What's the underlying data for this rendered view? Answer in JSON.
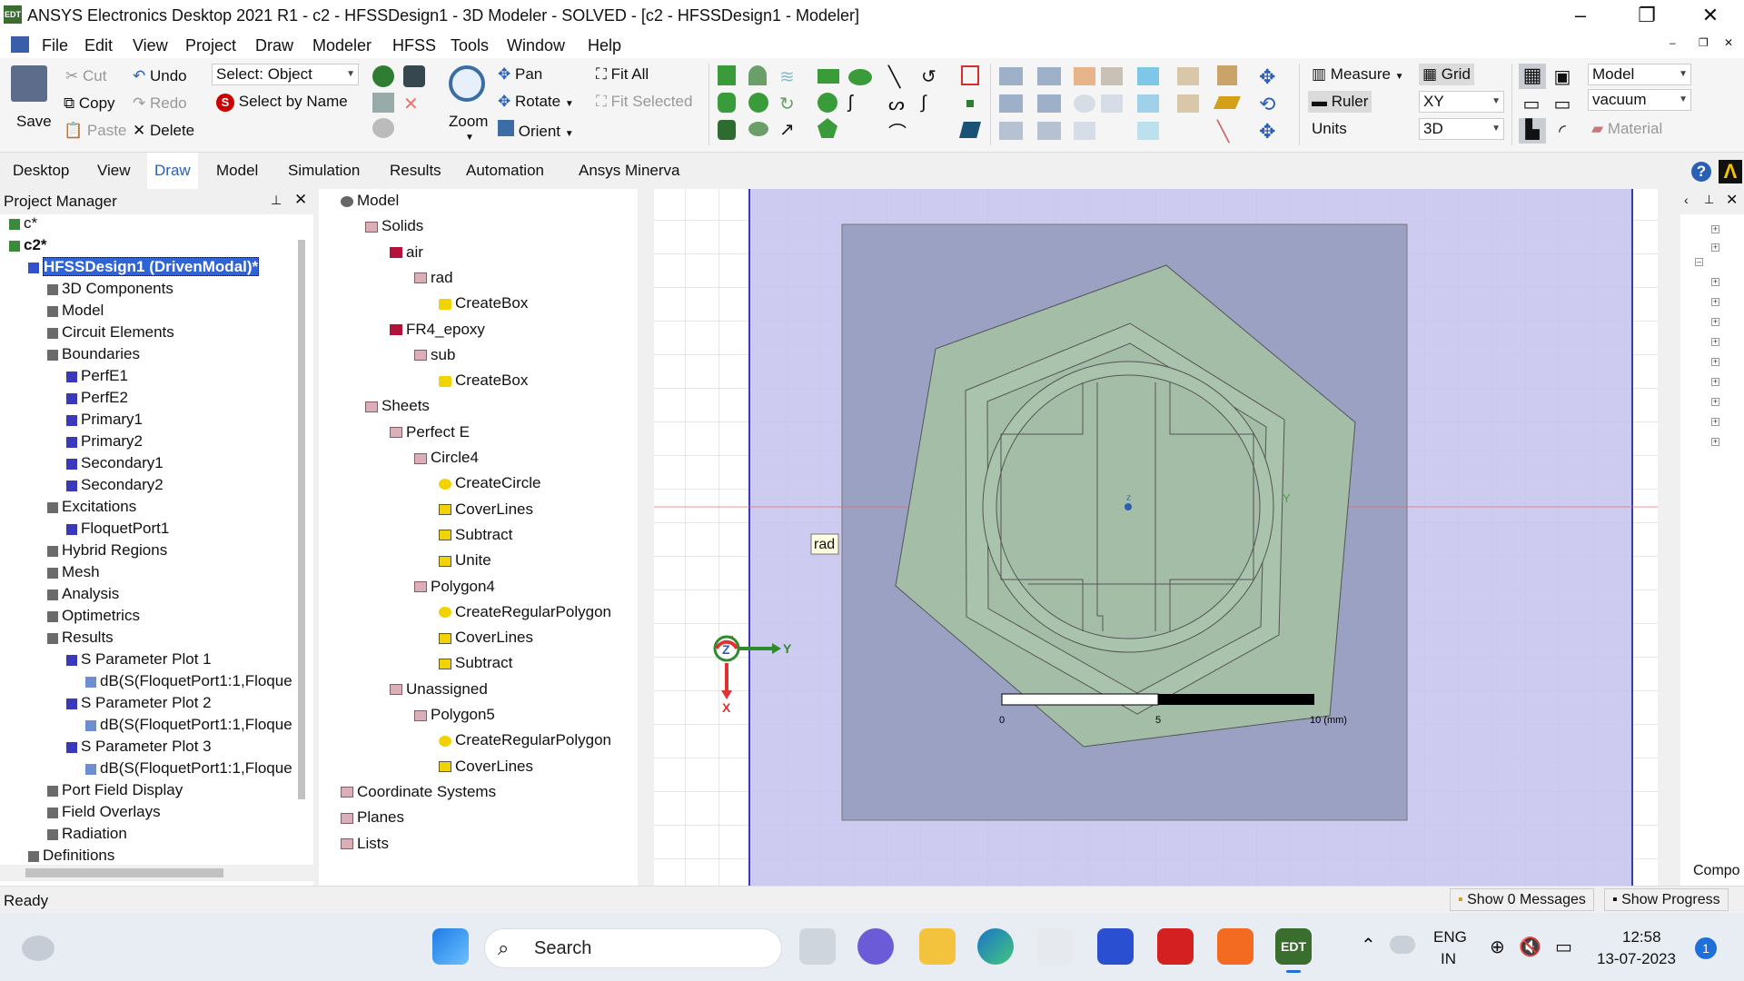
{
  "window": {
    "title": "ANSYS Electronics Desktop 2021 R1 - c2 - HFSSDesign1 - 3D Modeler - SOLVED - [c2 - HFSSDesign1 - Modeler]",
    "logo": "EDT",
    "controls": [
      "–",
      "❐",
      "✕"
    ]
  },
  "menu": [
    "File",
    "Edit",
    "View",
    "Project",
    "Draw",
    "Modeler",
    "HFSS",
    "Tools",
    "Window",
    "Help"
  ],
  "ribbon": {
    "save": "Save",
    "cut": "Cut",
    "copy": "Copy",
    "paste": "Paste",
    "undo": "Undo",
    "redo": "Redo",
    "delete": "Delete",
    "select_label": "Select: Object",
    "select_by_name": "Select by Name",
    "zoom": "Zoom",
    "pan": "Pan",
    "rotate": "Rotate",
    "orient": "Orient",
    "fit_all": "Fit All",
    "fit_selected": "Fit Selected",
    "measure": "Measure",
    "ruler": "Ruler",
    "units": "Units",
    "grid": "Grid",
    "plane": "XY",
    "dim": "3D",
    "model": "Model",
    "material_value": "vacuum",
    "material": "Material"
  },
  "tabs": [
    "Desktop",
    "View",
    "Draw",
    "Model",
    "Simulation",
    "Results",
    "Automation",
    "Ansys Minerva"
  ],
  "project_manager": {
    "title": "Project Manager",
    "items": [
      {
        "label": "c*",
        "level": 0
      },
      {
        "label": "c2*",
        "level": 0
      },
      {
        "label": "HFSSDesign1 (DrivenModal)*",
        "level": 1
      },
      {
        "label": "3D Components",
        "level": 2
      },
      {
        "label": "Model",
        "level": 2
      },
      {
        "label": "Circuit Elements",
        "level": 2
      },
      {
        "label": "Boundaries",
        "level": 2
      },
      {
        "label": "PerfE1",
        "level": 3
      },
      {
        "label": "PerfE2",
        "level": 3
      },
      {
        "label": "Primary1",
        "level": 3
      },
      {
        "label": "Primary2",
        "level": 3
      },
      {
        "label": "Secondary1",
        "level": 3
      },
      {
        "label": "Secondary2",
        "level": 3
      },
      {
        "label": "Excitations",
        "level": 2
      },
      {
        "label": "FloquetPort1",
        "level": 3
      },
      {
        "label": "Hybrid Regions",
        "level": 2
      },
      {
        "label": "Mesh",
        "level": 2
      },
      {
        "label": "Analysis",
        "level": 2
      },
      {
        "label": "Optimetrics",
        "level": 2
      },
      {
        "label": "Results",
        "level": 2
      },
      {
        "label": "S Parameter Plot 1",
        "level": 3
      },
      {
        "label": "dB(S(FloquetPort1:1,Floque",
        "level": 4
      },
      {
        "label": "S Parameter Plot 2",
        "level": 3
      },
      {
        "label": "dB(S(FloquetPort1:1,Floque",
        "level": 4
      },
      {
        "label": "S Parameter Plot 3",
        "level": 3
      },
      {
        "label": "dB(S(FloquetPort1:1,Floque",
        "level": 4
      },
      {
        "label": "Port Field Display",
        "level": 2
      },
      {
        "label": "Field Overlays",
        "level": 2
      },
      {
        "label": "Radiation",
        "level": 2
      },
      {
        "label": "Definitions",
        "level": 1
      }
    ]
  },
  "model_tree": {
    "items": [
      {
        "label": "Model",
        "level": 0
      },
      {
        "label": "Solids",
        "level": 1
      },
      {
        "label": "air",
        "level": 2
      },
      {
        "label": "rad",
        "level": 3
      },
      {
        "label": "CreateBox",
        "level": 4
      },
      {
        "label": "FR4_epoxy",
        "level": 2
      },
      {
        "label": "sub",
        "level": 3
      },
      {
        "label": "CreateBox",
        "level": 4
      },
      {
        "label": "Sheets",
        "level": 1
      },
      {
        "label": "Perfect E",
        "level": 2
      },
      {
        "label": "Circle4",
        "level": 3
      },
      {
        "label": "CreateCircle",
        "level": 4
      },
      {
        "label": "CoverLines",
        "level": 4
      },
      {
        "label": "Subtract",
        "level": 4
      },
      {
        "label": "Unite",
        "level": 4
      },
      {
        "label": "Polygon4",
        "level": 3
      },
      {
        "label": "CreateRegularPolygon",
        "level": 4
      },
      {
        "label": "CoverLines",
        "level": 4
      },
      {
        "label": "Subtract",
        "level": 4
      },
      {
        "label": "Unassigned",
        "level": 2
      },
      {
        "label": "Polygon5",
        "level": 3
      },
      {
        "label": "CreateRegularPolygon",
        "level": 4
      },
      {
        "label": "CoverLines",
        "level": 4
      },
      {
        "label": "Coordinate Systems",
        "level": 0
      },
      {
        "label": "Planes",
        "level": 0
      },
      {
        "label": "Lists",
        "level": 0
      }
    ]
  },
  "viewport": {
    "tooltip": "rad",
    "axis_z": "Z",
    "axis_y": "Y",
    "axis_x": "X",
    "scale_labels": [
      "0",
      "5",
      "10 (mm)"
    ]
  },
  "right_panel": {
    "label": "Compo"
  },
  "status": {
    "text": "Ready",
    "messages": "Show 0 Messages",
    "progress": "Show Progress"
  },
  "taskbar": {
    "search": "Search",
    "lang1": "ENG",
    "lang2": "IN",
    "time": "12:58",
    "date": "13-07-2023",
    "notif": "1"
  }
}
